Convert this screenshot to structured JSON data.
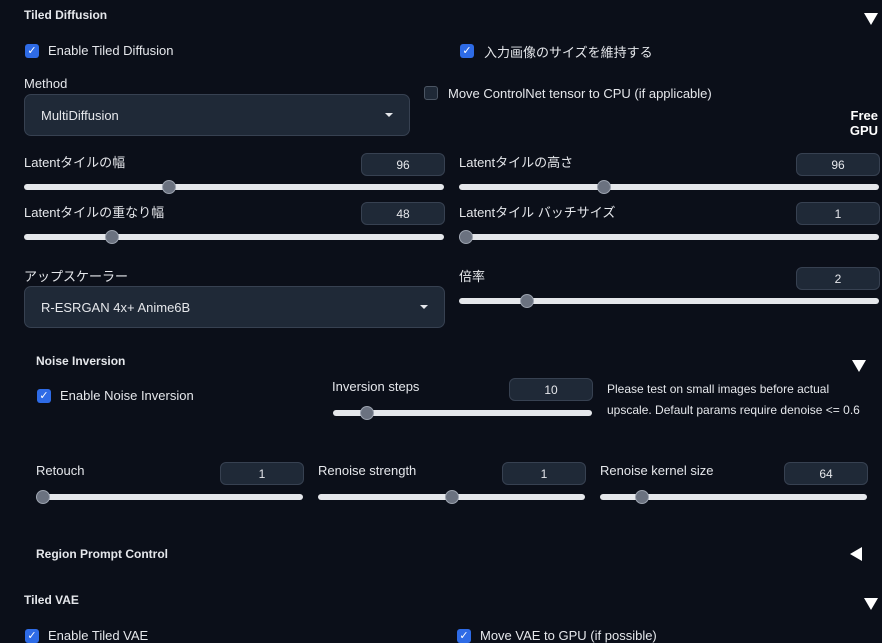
{
  "tiled_diffusion": {
    "title": "Tiled Diffusion",
    "enable_label": "Enable Tiled Diffusion",
    "keep_size_label": "入力画像のサイズを維持する",
    "method_label": "Method",
    "method_value": "MultiDiffusion",
    "move_controlnet_label": "Move ControlNet tensor to CPU (if applicable)",
    "free_gpu_line1": "Free",
    "free_gpu_line2": "GPU",
    "sliders": {
      "tile_width": {
        "label": "Latentタイルの幅",
        "value": "96",
        "fraction": 0.34
      },
      "tile_height": {
        "label": "Latentタイルの高さ",
        "value": "96",
        "fraction": 0.34
      },
      "tile_overlap": {
        "label": "Latentタイルの重なり幅",
        "value": "48",
        "fraction": 0.2
      },
      "batch_size": {
        "label": "Latentタイル バッチサイズ",
        "value": "1",
        "fraction": 0.0
      },
      "scale": {
        "label": "倍率",
        "value": "2",
        "fraction": 0.15
      }
    },
    "upscaler_label": "アップスケーラー",
    "upscaler_value": "R-ESRGAN 4x+ Anime6B"
  },
  "noise_inversion": {
    "title": "Noise Inversion",
    "enable_label": "Enable Noise Inversion",
    "note": "Please test on small images before actual upscale. Default params require denoise <= 0.6",
    "sliders": {
      "steps": {
        "label": "Inversion steps",
        "value": "10",
        "fraction": 0.11
      },
      "retouch": {
        "label": "Retouch",
        "value": "1",
        "fraction": 0.0
      },
      "renoise_strength": {
        "label": "Renoise strength",
        "value": "1",
        "fraction": 0.5
      },
      "renoise_kernel": {
        "label": "Renoise kernel size",
        "value": "64",
        "fraction": 0.14
      }
    }
  },
  "region_prompt": {
    "title": "Region Prompt Control"
  },
  "tiled_vae": {
    "title": "Tiled VAE",
    "enable_label": "Enable Tiled VAE",
    "move_vae_label": "Move VAE to GPU (if possible)"
  },
  "colors": {
    "accent": "#2e6be6",
    "background": "#0b0f19",
    "panel": "#1f2937"
  }
}
